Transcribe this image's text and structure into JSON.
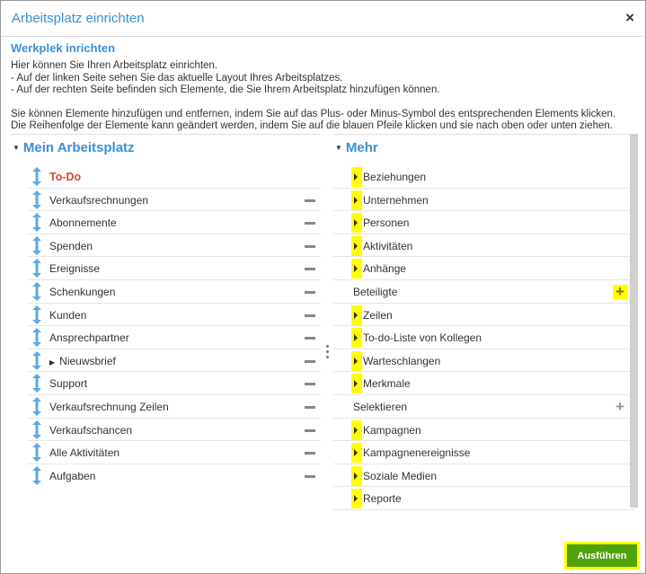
{
  "dialog": {
    "title": "Arbeitsplatz einrichten",
    "close_glyph": "×"
  },
  "content": {
    "subtitle": "Werkplek inrichten",
    "intro_lines": [
      "Hier können Sie Ihren Arbeitsplatz einrichten.",
      "- Auf der linken Seite sehen Sie das aktuelle Layout Ihres Arbeitsplatzes.",
      "- Auf der rechten Seite befinden sich Elemente, die Sie Ihrem Arbeitsplatz hinzufügen können."
    ],
    "intro_lines_2": [
      "Sie können Elemente hinzufügen und entfernen, indem Sie auf das Plus- oder Minus-Symbol des entsprechenden Elements klicken.",
      "Die Reihenfolge der Elemente kann geändert werden, indem Sie auf die blauen Pfeile klicken und sie nach oben oder unten ziehen."
    ]
  },
  "left": {
    "heading": "Mein Arbeitsplatz",
    "items": [
      {
        "label": "To-Do",
        "removable": false,
        "highlight": true,
        "expandable": false
      },
      {
        "label": "Verkaufsrechnungen",
        "removable": true,
        "highlight": false,
        "expandable": false
      },
      {
        "label": "Abonnemente",
        "removable": true,
        "highlight": false,
        "expandable": false
      },
      {
        "label": "Spenden",
        "removable": true,
        "highlight": false,
        "expandable": false
      },
      {
        "label": "Ereignisse",
        "removable": true,
        "highlight": false,
        "expandable": false
      },
      {
        "label": "Schenkungen",
        "removable": true,
        "highlight": false,
        "expandable": false
      },
      {
        "label": "Kunden",
        "removable": true,
        "highlight": false,
        "expandable": false
      },
      {
        "label": "Ansprechpartner",
        "removable": true,
        "highlight": false,
        "expandable": false
      },
      {
        "label": "Nieuwsbrief",
        "removable": true,
        "highlight": false,
        "expandable": true
      },
      {
        "label": "Support",
        "removable": true,
        "highlight": false,
        "expandable": false
      },
      {
        "label": "Verkaufsrechnung Zeilen",
        "removable": true,
        "highlight": false,
        "expandable": false
      },
      {
        "label": "Verkaufschancen",
        "removable": true,
        "highlight": false,
        "expandable": false
      },
      {
        "label": "Alle Aktivitäten",
        "removable": true,
        "highlight": false,
        "expandable": false
      },
      {
        "label": "Aufgaben",
        "removable": true,
        "highlight": false,
        "expandable": false
      }
    ]
  },
  "right": {
    "heading": "Mehr",
    "items": [
      {
        "label": "Beziehungen",
        "group": true,
        "plus": false
      },
      {
        "label": "Unternehmen",
        "group": true,
        "plus": false
      },
      {
        "label": "Personen",
        "group": true,
        "plus": false
      },
      {
        "label": "Aktivitäten",
        "group": true,
        "plus": false
      },
      {
        "label": "Anhänge",
        "group": true,
        "plus": false
      },
      {
        "label": "Beteiligte",
        "group": false,
        "plus": true,
        "plus_highlight": true
      },
      {
        "label": "Zeilen",
        "group": true,
        "plus": false
      },
      {
        "label": "To-do-Liste von Kollegen",
        "group": true,
        "plus": false
      },
      {
        "label": "Warteschlangen",
        "group": true,
        "plus": false
      },
      {
        "label": "Merkmale",
        "group": true,
        "plus": false
      },
      {
        "label": "Selektieren",
        "group": false,
        "plus": true,
        "plus_highlight": false
      },
      {
        "label": "Kampagnen",
        "group": true,
        "plus": false
      },
      {
        "label": "Kampagnenereignisse",
        "group": true,
        "plus": false
      },
      {
        "label": "Soziale Medien",
        "group": true,
        "plus": false
      },
      {
        "label": "Reporte",
        "group": true,
        "plus": false
      }
    ]
  },
  "footer": {
    "run_label": "Ausführen"
  },
  "colors": {
    "accent": "#3a8fd6",
    "todo": "#d9473a",
    "highlight": "#ffff00",
    "run_button": "#4ea30a"
  }
}
